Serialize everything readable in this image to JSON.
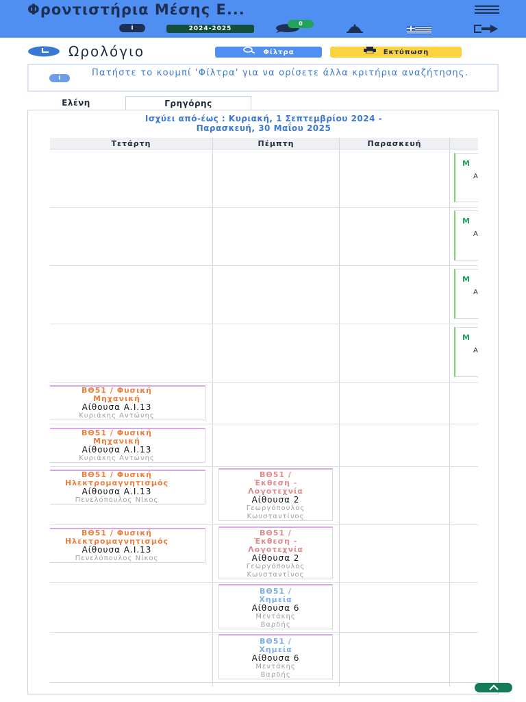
{
  "app": {
    "title": "Φροντιστήρια Μέσης Ε...",
    "info_badge": "i",
    "year": "2024-2025",
    "messages_count": "0",
    "icons": [
      "menu-icon",
      "info-icon",
      "chat-icon",
      "bell-icon",
      "greek-flag-icon",
      "logout-icon"
    ]
  },
  "page": {
    "title": "Ωρολόγιο",
    "filter_label": "Φίλτρα",
    "print_label": "Εκτύπωση",
    "alert_icon": "i",
    "alert_text": "Πατήστε το κουμπί 'Φίλτρα' για να ορίσετε άλλα κριτήρια αναζήτησης."
  },
  "tabs": [
    {
      "label": "Ελένη",
      "active": false
    },
    {
      "label": "Γρηγόρης",
      "active": true
    }
  ],
  "schedule": {
    "validity_line1": "Ισχύει από-έως : Κυριακή, 1 Σεπτεμβρίου 2024 -",
    "validity_line2": "Παρασκευή, 30 Μαΐου 2025",
    "days": [
      "Τετάρτη",
      "Πέμπτη",
      "Παρασκευή"
    ],
    "green_card_letters": [
      "Μ",
      "Α"
    ],
    "wednesday_cards": [
      {
        "subject_1": "ΒΘ51 / Φυσική",
        "subject_2": "Μηχανική",
        "room": "Αίθουσα Α.Ι.13",
        "teacher": "Κυριάκης Αντώνης"
      },
      {
        "subject_1": "ΒΘ51 / Φυσική",
        "subject_2": "Μηχανική",
        "room": "Αίθουσα Α.Ι.13",
        "teacher": "Κυριάκης Αντώνης"
      },
      {
        "subject_1": "ΒΘ51 / Φυσική",
        "subject_2": "Ηλεκτρομαγνητισμός",
        "room": "Αίθουσα Α.Ι.13",
        "teacher": "Πενελόπουλος Νίκος"
      },
      {
        "subject_1": "ΒΘ51 / Φυσική",
        "subject_2": "Ηλεκτρομαγνητισμός",
        "room": "Αίθουσα Α.Ι.13",
        "teacher": "Πενελόπουλος Νίκος"
      }
    ],
    "thursday_cards": [
      {
        "subject_1": "ΒΘ51 /",
        "subject_2": "Έκθεση -",
        "subject_3": "Λογοτεχνία",
        "room": "Αίθουσα 2",
        "teacher_1": "Γεωργόπουλος",
        "teacher_2": "Κωνσταντίνος"
      },
      {
        "subject_1": "ΒΘ51 /",
        "subject_2": "Έκθεση -",
        "subject_3": "Λογοτεχνία",
        "room": "Αίθουσα 2",
        "teacher_1": "Γεωργόπουλος",
        "teacher_2": "Κωνσταντίνος"
      },
      {
        "subject_1": "ΒΘ51 /",
        "subject_2": "Χημεία",
        "room": "Αίθουσα 6",
        "teacher_1": "Μεντάκης",
        "teacher_2": "Βαρδής"
      },
      {
        "subject_1": "ΒΘ51 /",
        "subject_2": "Χημεία",
        "room": "Αίθουσα 6",
        "teacher_1": "Μεντάκης",
        "teacher_2": "Βαρδής"
      }
    ]
  },
  "colors": {
    "topbar": "#4f8ff2",
    "physics": "#f07d3a",
    "literature": "#e08a8a",
    "chemistry": "#7fb0e8",
    "accent_green": "#22a35a",
    "print_button": "#fbd23f"
  }
}
